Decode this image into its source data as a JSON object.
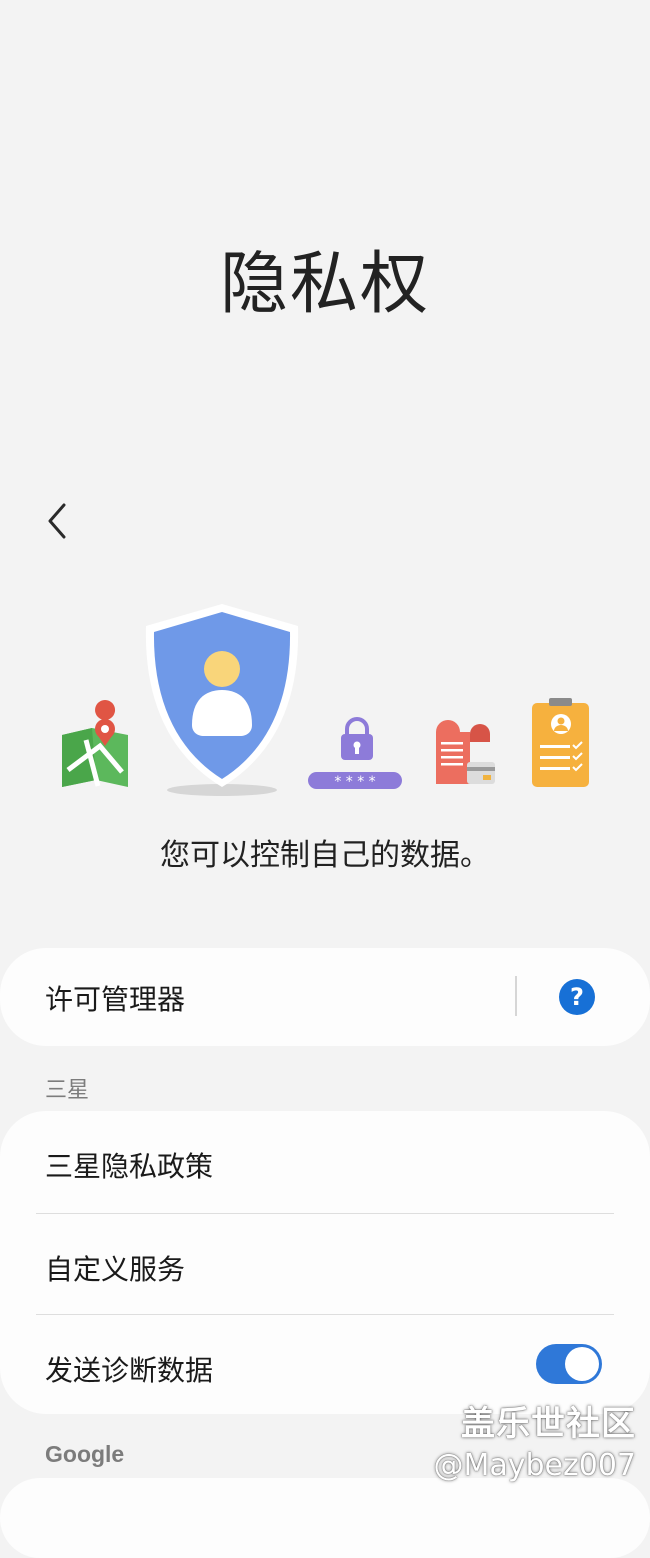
{
  "page": {
    "title": "隐私权"
  },
  "tagline": "您可以控制自己的数据。",
  "permission_manager": {
    "label": "许可管理器",
    "help_icon": "question-mark-icon",
    "help_glyph": "?"
  },
  "samsung": {
    "header": "三星",
    "items": [
      {
        "label": "三星隐私政策"
      },
      {
        "label": "自定义服务"
      },
      {
        "label": "发送诊断数据",
        "toggle_on": true
      }
    ]
  },
  "google": {
    "header": "Google"
  },
  "illustration": {
    "password_mask": "* * * *"
  },
  "colors": {
    "accent": "#2f78d8",
    "shield": "#6f99e8",
    "help": "#1770d6"
  },
  "watermark": {
    "line1": "盖乐世社区",
    "line2": "@Maybez007"
  }
}
